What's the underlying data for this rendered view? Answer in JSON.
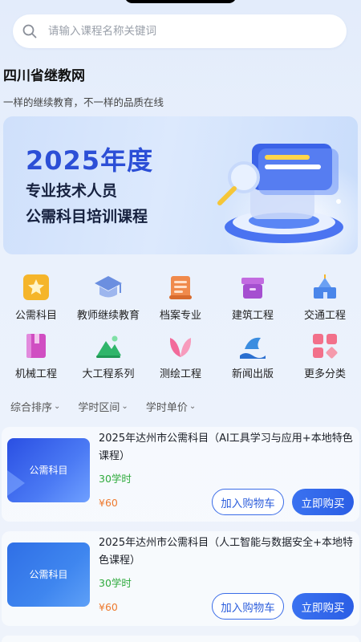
{
  "search": {
    "placeholder": "请输入课程名称关键词"
  },
  "site": {
    "title": "四川省继教网",
    "slogan": "一样的继续教育，不一样的品质在线"
  },
  "banner": {
    "line1": "2025年度",
    "line2": "专业技术人员",
    "line3": "公需科目培训课程"
  },
  "categories": [
    {
      "label": "公需科目",
      "icon": "star-badge-icon"
    },
    {
      "label": "教师继续教育",
      "icon": "graduation-cap-icon"
    },
    {
      "label": "档案专业",
      "icon": "scroll-icon"
    },
    {
      "label": "建筑工程",
      "icon": "archive-box-icon"
    },
    {
      "label": "交通工程",
      "icon": "building-icon"
    },
    {
      "label": "机械工程",
      "icon": "book-icon"
    },
    {
      "label": "大工程系列",
      "icon": "mountain-icon"
    },
    {
      "label": "测绘工程",
      "icon": "leaf-icon"
    },
    {
      "label": "新闻出版",
      "icon": "fish-wave-icon"
    },
    {
      "label": "更多分类",
      "icon": "grid-icon"
    }
  ],
  "filters": [
    {
      "label": "综合排序"
    },
    {
      "label": "学时区间"
    },
    {
      "label": "学时单价"
    }
  ],
  "courses": [
    {
      "thumb_label": "公需科目",
      "title": "2025年达州市公需科目（AI工具学习与应用+本地特色课程）",
      "hours": "30学时",
      "price": "¥60",
      "cart_label": "加入购物车",
      "buy_label": "立即购买"
    },
    {
      "thumb_label": "公需科目",
      "title": "2025年达州市公需科目（人工智能与数据安全+本地特色课程）",
      "hours": "30学时",
      "price": "¥60",
      "cart_label": "加入购物车",
      "buy_label": "立即购买"
    }
  ],
  "colors": {
    "accent": "#2e5fdc",
    "hours": "#2eaa3c",
    "price": "#ee7a2f"
  }
}
